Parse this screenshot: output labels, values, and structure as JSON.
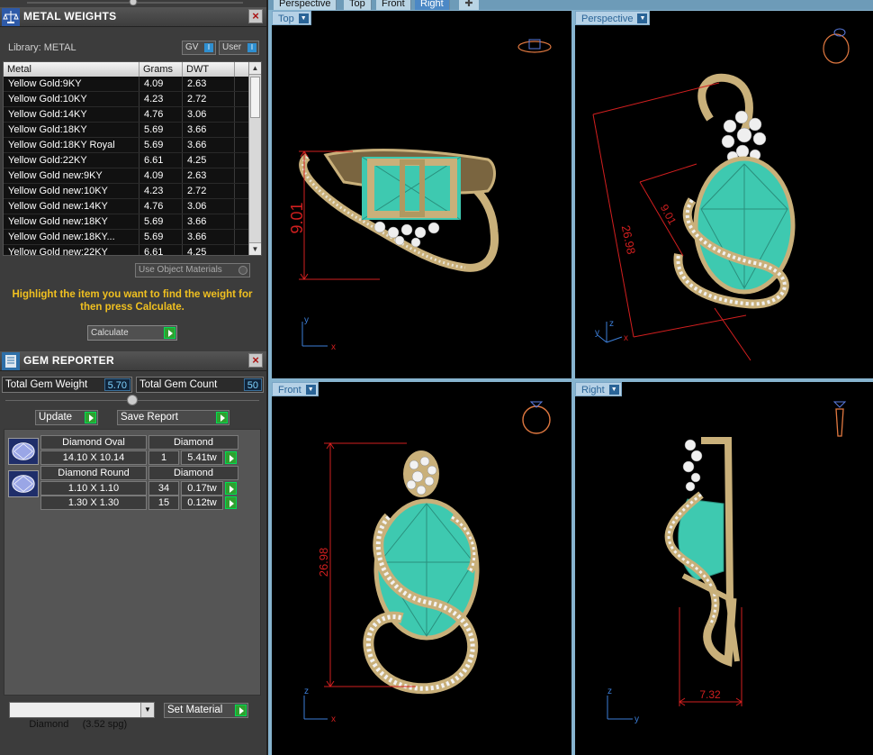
{
  "metal_panel": {
    "title": "METAL WEIGHTS",
    "library_label": "Library: METAL",
    "gv_button": "GV",
    "user_button": "User",
    "columns": [
      "Metal",
      "Grams",
      "DWT"
    ],
    "rows": [
      [
        "Yellow Gold:9KY",
        "4.09",
        "2.63"
      ],
      [
        "Yellow Gold:10KY",
        "4.23",
        "2.72"
      ],
      [
        "Yellow Gold:14KY",
        "4.76",
        "3.06"
      ],
      [
        "Yellow Gold:18KY",
        "5.69",
        "3.66"
      ],
      [
        "Yellow Gold:18KY Royal",
        "5.69",
        "3.66"
      ],
      [
        "Yellow Gold:22KY",
        "6.61",
        "4.25"
      ],
      [
        "Yellow Gold new:9KY",
        "4.09",
        "2.63"
      ],
      [
        "Yellow Gold new:10KY",
        "4.23",
        "2.72"
      ],
      [
        "Yellow Gold new:14KY",
        "4.76",
        "3.06"
      ],
      [
        "Yellow Gold new:18KY",
        "5.69",
        "3.66"
      ],
      [
        "Yellow Gold new:18KY...",
        "5.69",
        "3.66"
      ],
      [
        "Yellow Gold new:22KY",
        "6.61",
        "4.25"
      ]
    ],
    "use_object_materials": "Use Object Materials",
    "hint": "Highlight the item you want to find the weight for then press Calculate.",
    "calculate": "Calculate"
  },
  "gem_panel": {
    "title": "GEM REPORTER",
    "total_weight_label": "Total Gem Weight",
    "total_weight_value": "5.70",
    "total_count_label": "Total Gem Count",
    "total_count_value": "50",
    "update": "Update",
    "save_report": "Save Report",
    "groups": [
      {
        "shape": "Diamond Oval",
        "material": "Diamond",
        "rows": [
          [
            "14.10 X 10.14",
            "1",
            "5.41tw"
          ]
        ]
      },
      {
        "shape": "Diamond Round",
        "material": "Diamond",
        "rows": [
          [
            "1.10 X 1.10",
            "34",
            "0.17tw"
          ],
          [
            "1.30 X 1.30",
            "15",
            "0.12tw"
          ]
        ]
      }
    ],
    "material_select": "Diamond     (3.52 spg)",
    "set_material": "Set Material"
  },
  "tabs": [
    "Perspective",
    "Top",
    "Front",
    "Right"
  ],
  "active_tab": "Right",
  "viewports": {
    "top": {
      "label": "Top",
      "dimension": "9.01"
    },
    "perspective": {
      "label": "Perspective",
      "dimension_a": "26.98",
      "dimension_b": "9.01"
    },
    "front": {
      "label": "Front",
      "dimension": "26.98"
    },
    "right": {
      "label": "Right",
      "dimension": "7.32"
    }
  },
  "axes": {
    "x": "x",
    "y": "y",
    "z": "z"
  },
  "colors": {
    "gold": "#c9b07a",
    "gem": "#3ec9b0",
    "dim": "#d21f1f",
    "panel": "#3c3c3c"
  }
}
